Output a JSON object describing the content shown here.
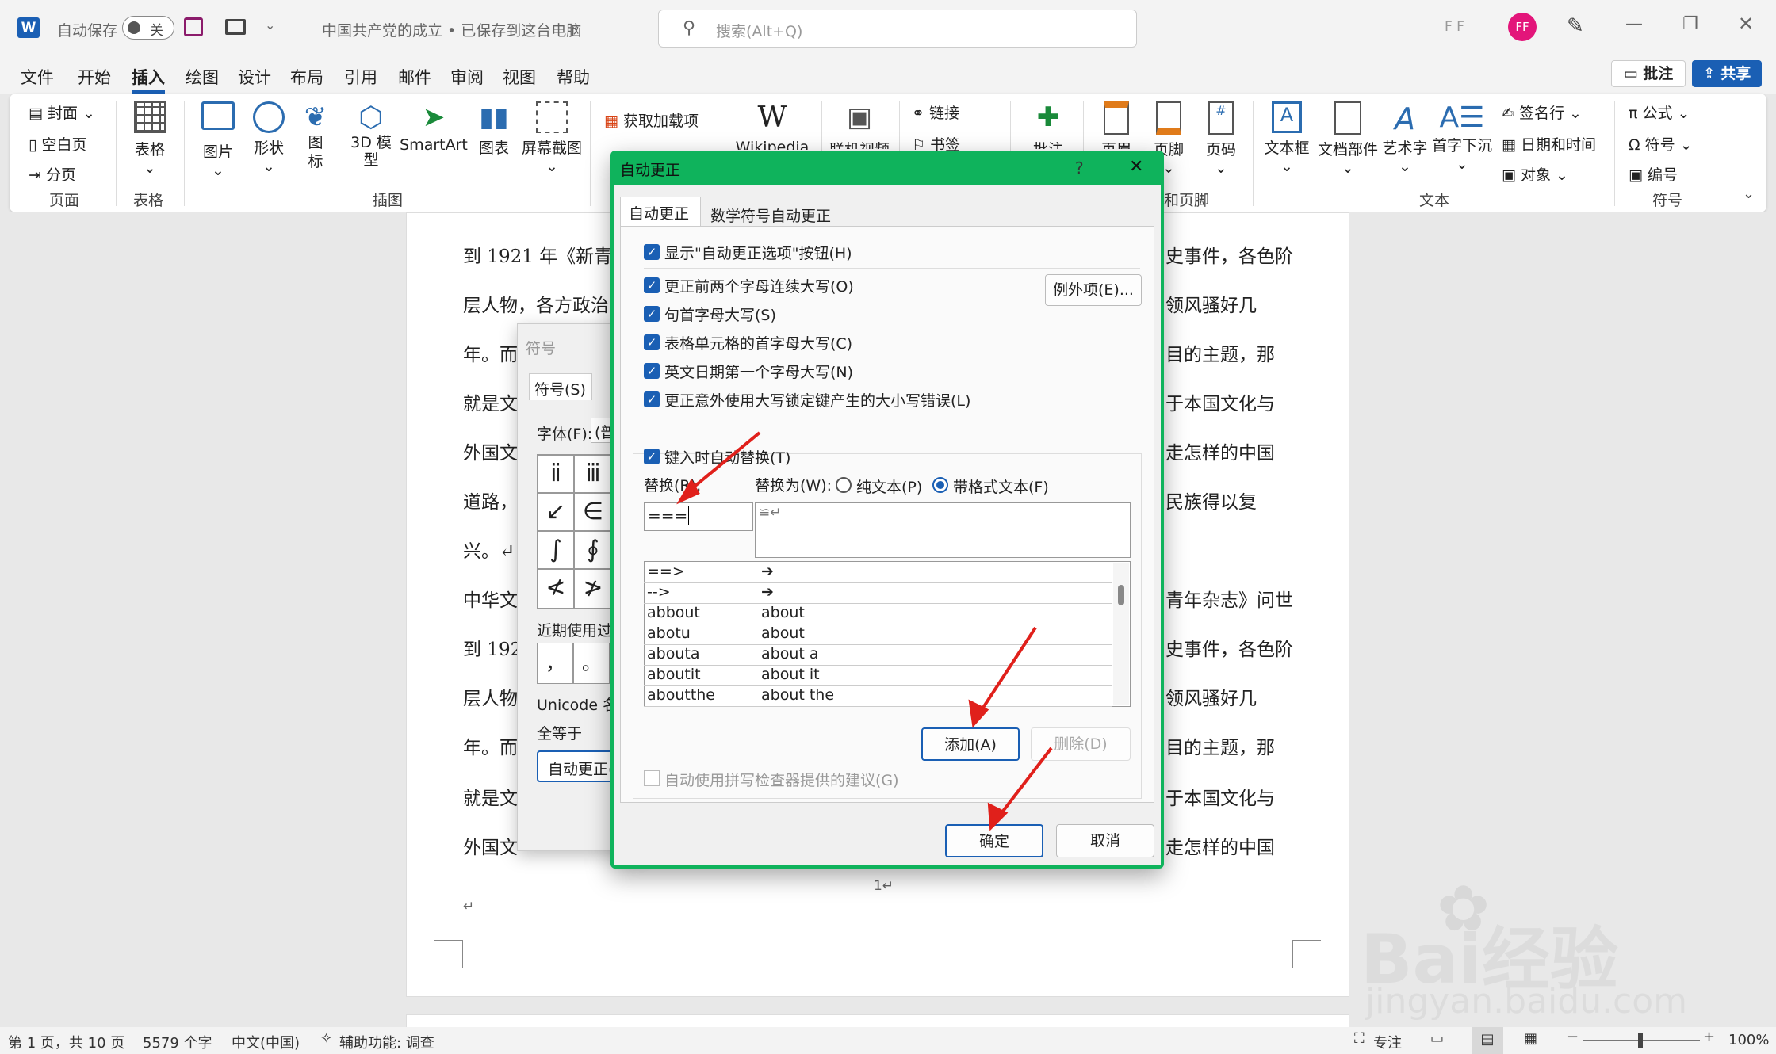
{
  "titlebar": {
    "autosave_label": "自动保存",
    "autosave_state": "关",
    "doc_title": "中国共产党的成立 • 已保存到这台电脑",
    "search_placeholder": "搜索(Alt+Q)",
    "user_initials": "F F",
    "avatar": "FF"
  },
  "tabs": [
    "文件",
    "开始",
    "插入",
    "绘图",
    "设计",
    "布局",
    "引用",
    "邮件",
    "审阅",
    "视图",
    "帮助"
  ],
  "active_tab": "插入",
  "top_right": {
    "comments": "批注",
    "share": "共享"
  },
  "ribbon": {
    "pages": {
      "cover": "封面",
      "blank": "空白页",
      "break": "分页",
      "group": "页面"
    },
    "tables": {
      "table": "表格",
      "group": "表格"
    },
    "illustrations": {
      "picture": "图片",
      "shapes": "形状",
      "icons": "图\n标",
      "model3d": "3D 模\n型",
      "smartart": "SmartArt",
      "chart": "图表",
      "screenshot": "屏幕截图",
      "group": "插图"
    },
    "addins": {
      "get": "获取加载项",
      "wikipedia": "Wikipedia"
    },
    "media": {
      "video": "联机视频"
    },
    "links": {
      "link": "链接",
      "bookmark": "书签"
    },
    "comments": {
      "comment": "批注"
    },
    "header_footer": {
      "header": "页眉",
      "footer": "页脚",
      "page_number": "页码",
      "group": "和页脚"
    },
    "text": {
      "textbox": "文本框",
      "parts": "文档部件",
      "wordart": "艺术字",
      "dropcap": "首字下沉",
      "signature": "签名行",
      "datetime": "日期和时间",
      "object": "对象",
      "group": "文本"
    },
    "symbols": {
      "equation": "公式",
      "symbol": "符号",
      "number": "编号",
      "group": "符号"
    }
  },
  "document": {
    "lines_left": [
      "到 1921 年《新青",
      "层人物，各方政治",
      "年。而",
      "就是文",
      "外国文",
      "道路，",
      "兴。↵",
      "中华文",
      "到 192",
      "层人物",
      "年。而",
      "就是文",
      "外国文"
    ],
    "lines_right": [
      "史事件，各色阶",
      "领风骚好几",
      "目的主题，那",
      "于本国文化与",
      "走怎样的中国",
      "民族得以复",
      "",
      "青年杂志》问世",
      "史事件，各色阶",
      "领风骚好几",
      "目的主题，那",
      "于本国文化与",
      "走怎样的中国"
    ],
    "page_marker": "1↵",
    "para_mark": "↵"
  },
  "symbol_dialog": {
    "title": "符号",
    "tab": "符号(S)",
    "font_label": "字体(F):",
    "font_value": "(普",
    "symbols": [
      "ⅱ",
      "ⅲ",
      "↙",
      "∈",
      "∫",
      "∮",
      "≮",
      "≯"
    ],
    "recent_label": "近期使用过",
    "recent": [
      "，",
      "。"
    ],
    "unicode_label": "Unicode 名",
    "char_name": "全等于",
    "autocorrect_btn": "自动更正("
  },
  "autocorrect": {
    "title": "自动更正",
    "help": "?",
    "close": "✕",
    "tabs": [
      "自动更正",
      "数学符号自动更正"
    ],
    "options": [
      "显示\"自动更正选项\"按钮(H)",
      "更正前两个字母连续大写(O)",
      "句首字母大写(S)",
      "表格单元格的首字母大写(C)",
      "英文日期第一个字母大写(N)",
      "更正意外使用大写锁定键产生的大小写错误(L)"
    ],
    "exceptions_btn": "例外项(E)...",
    "replace_as_type": "键入时自动替换(T)",
    "replace_label": "替换(R):",
    "with_label": "替换为(W):",
    "plain_text": "纯文本(P)",
    "formatted_text": "带格式文本(F)",
    "replace_value": "===",
    "with_value": "≌↵",
    "table": [
      {
        "from": "==>",
        "to": "➔"
      },
      {
        "from": "-->",
        "to": "➔"
      },
      {
        "from": "abbout",
        "to": "about"
      },
      {
        "from": "abotu",
        "to": "about"
      },
      {
        "from": "abouta",
        "to": "about a"
      },
      {
        "from": "aboutit",
        "to": "about it"
      },
      {
        "from": "aboutthe",
        "to": "about the"
      }
    ],
    "add_btn": "添加(A)",
    "delete_btn": "删除(D)",
    "spell_suggest": "自动使用拼写检查器提供的建议(G)",
    "ok_btn": "确定",
    "cancel_btn": "取消"
  },
  "statusbar": {
    "page": "第 1 页，共 10 页",
    "words": "5579 个字",
    "lang": "中文(中国)",
    "accessibility": "辅助功能: 调查",
    "focus": "专注",
    "zoom": "100%"
  },
  "watermark": {
    "brand": "Bai经验",
    "url": "jingyan.baidu.com"
  },
  "colors": {
    "accent": "#1a5fb4",
    "dialog_border": "#0fb35c",
    "arrow": "#e0201b",
    "avatar": "#e3157a"
  }
}
